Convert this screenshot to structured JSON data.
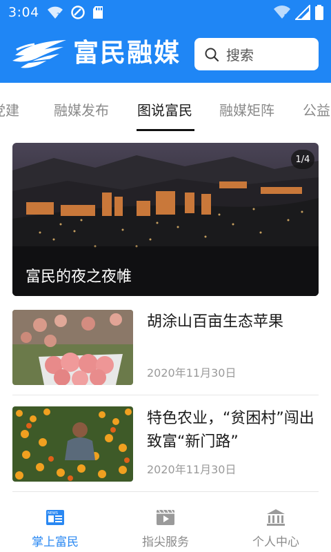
{
  "status_bar": {
    "time": "3:04"
  },
  "header": {
    "app_name": "富民融媒",
    "search_placeholder": "搜索",
    "brand_color": "#1f86f5"
  },
  "tabs": [
    {
      "label": "党建",
      "active": false
    },
    {
      "label": "融媒发布",
      "active": false
    },
    {
      "label": "图说富民",
      "active": true
    },
    {
      "label": "融媒矩阵",
      "active": false
    },
    {
      "label": "公益",
      "active": false
    }
  ],
  "carousel": {
    "counter": "1/4",
    "caption": "富民的夜之夜帷"
  },
  "news": [
    {
      "title": "胡涂山百亩生态苹果",
      "date": "2020年11月30日"
    },
    {
      "title": "特色农业，“贫困村”闯出致富“新门路”",
      "date": "2020年11月30日"
    }
  ],
  "bottom_nav": [
    {
      "label": "掌上富民",
      "icon": "news-icon",
      "active": true
    },
    {
      "label": "指尖服务",
      "icon": "video-icon",
      "active": false
    },
    {
      "label": "个人中心",
      "icon": "building-icon",
      "active": false
    }
  ],
  "colors": {
    "accent": "#2a88f2",
    "inactive": "#8a8a8a"
  }
}
